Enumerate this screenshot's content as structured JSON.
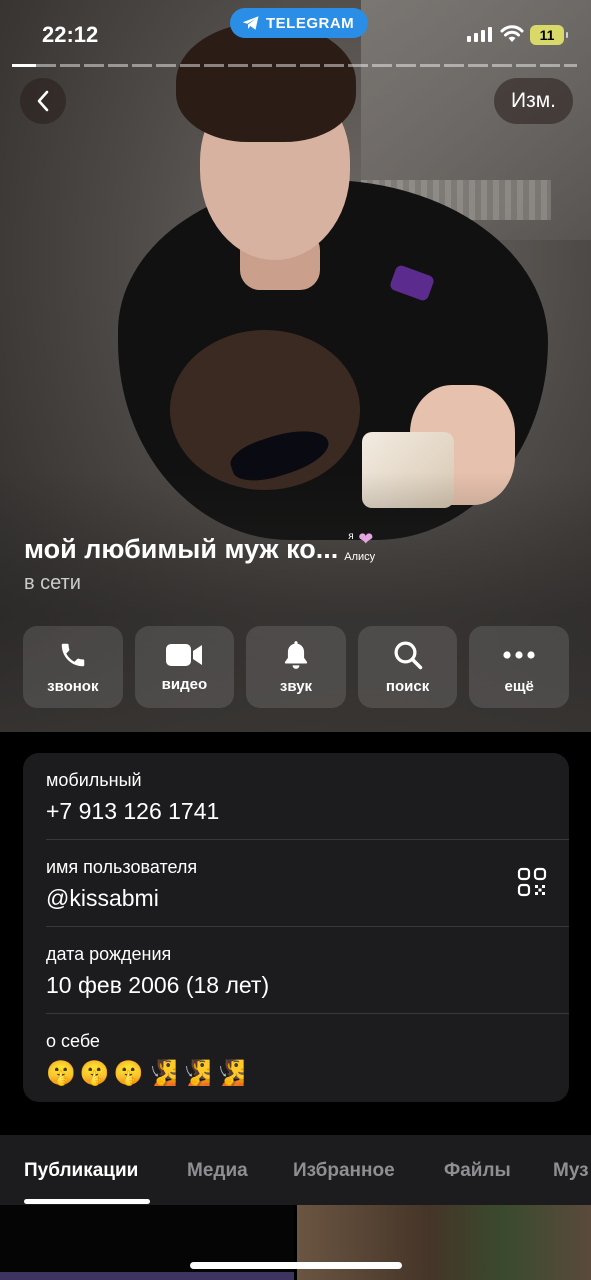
{
  "status_bar": {
    "time": "22:12",
    "app_pill": "TELEGRAM",
    "battery": "11"
  },
  "nav": {
    "edit_label": "Изм."
  },
  "profile": {
    "name": "мой любимый муж ко...",
    "emoji_status_top": "я",
    "emoji_status_bottom": "Алису",
    "status": "в сети"
  },
  "actions": [
    {
      "label": "звонок",
      "icon": "phone-icon"
    },
    {
      "label": "видео",
      "icon": "video-camera-icon"
    },
    {
      "label": "звук",
      "icon": "bell-icon"
    },
    {
      "label": "поиск",
      "icon": "search-icon"
    },
    {
      "label": "ещё",
      "icon": "more-dots-icon"
    }
  ],
  "info": {
    "mobile_label": "мобильный",
    "mobile_value": "+7 913 126 1741",
    "username_label": "имя пользователя",
    "username_value": "@kissabmi",
    "birthday_label": "дата рождения",
    "birthday_value": "10 фев 2006 (18 лет)",
    "about_label": "о себе",
    "about_emojis": [
      "🤫",
      "🤫",
      "🤫",
      "🧏",
      "🧏",
      "🧏"
    ]
  },
  "tabs": [
    "Публикации",
    "Медиа",
    "Избранное",
    "Файлы",
    "Муз"
  ],
  "colors": {
    "telegram_blue": "#2a8ee6",
    "card_bg": "#1c1c1e",
    "battery_low": "#d9d96a"
  }
}
